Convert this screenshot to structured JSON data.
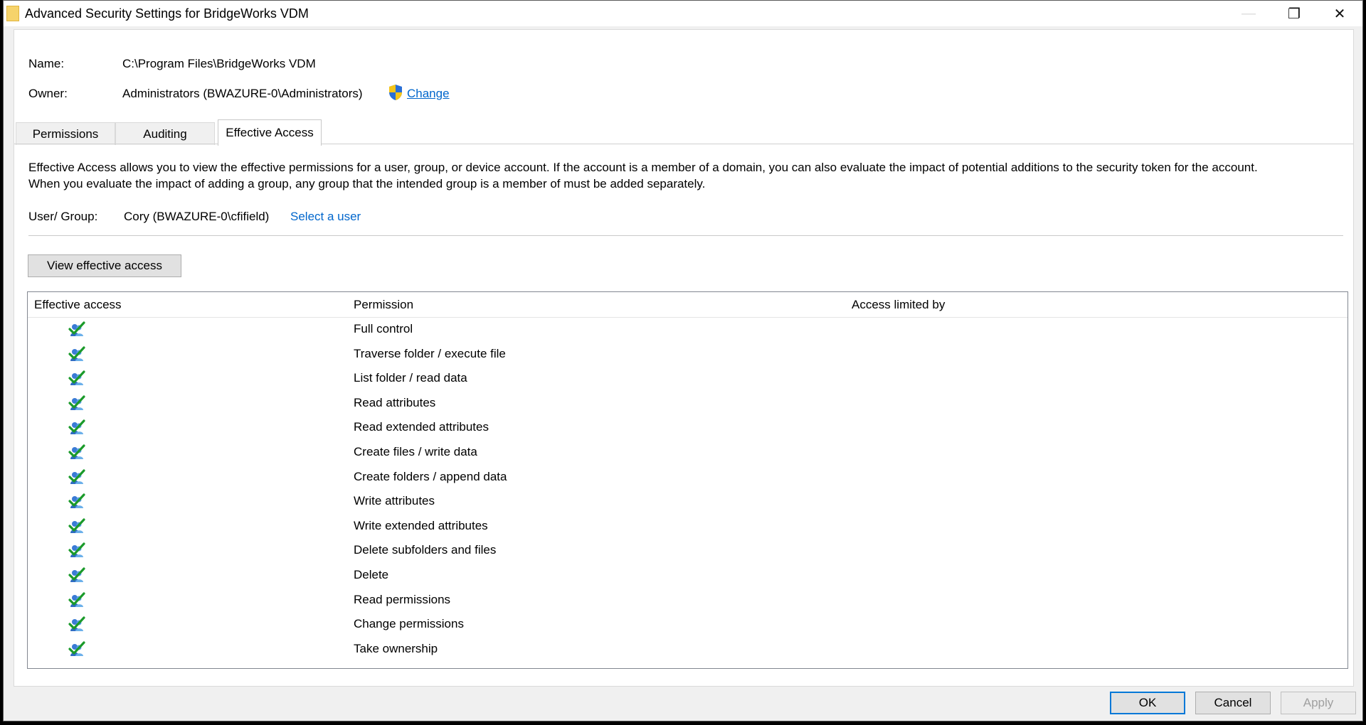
{
  "window": {
    "title": "Advanced Security Settings for BridgeWorks VDM",
    "minimize_label": "—",
    "maximize_label": "❐",
    "close_label": "✕"
  },
  "info": {
    "name_label": "Name:",
    "name_value": "C:\\Program Files\\BridgeWorks VDM",
    "owner_label": "Owner:",
    "owner_value": "Administrators (BWAZURE-0\\Administrators)",
    "change_link": "Change"
  },
  "tabs": [
    {
      "label": "Permissions",
      "active": false
    },
    {
      "label": "Auditing",
      "active": false
    },
    {
      "label": "Effective Access",
      "active": true
    }
  ],
  "effective": {
    "description_line1": "Effective Access allows you to view the effective permissions for a user, group, or device account. If the account is a member of a domain, you can also evaluate the impact of potential additions to the security token for the account.",
    "description_line2": "When you evaluate the impact of adding a group, any group that the intended group is a member of must be added separately.",
    "user_group_label": "User/ Group:",
    "user_group_value": "Cory (BWAZURE-0\\cfifield)",
    "select_user_link": "Select a user",
    "view_button": "View effective access"
  },
  "table": {
    "columns": [
      "Effective access",
      "Permission",
      "Access limited by"
    ],
    "rows": [
      {
        "permission": "Full control",
        "access_icon": "allowed-icon",
        "limited_by": ""
      },
      {
        "permission": "Traverse folder / execute file",
        "access_icon": "allowed-icon",
        "limited_by": ""
      },
      {
        "permission": "List folder / read data",
        "access_icon": "allowed-icon",
        "limited_by": ""
      },
      {
        "permission": "Read attributes",
        "access_icon": "allowed-icon",
        "limited_by": ""
      },
      {
        "permission": "Read extended attributes",
        "access_icon": "allowed-icon",
        "limited_by": ""
      },
      {
        "permission": "Create files / write data",
        "access_icon": "allowed-icon",
        "limited_by": ""
      },
      {
        "permission": "Create folders / append data",
        "access_icon": "allowed-icon",
        "limited_by": ""
      },
      {
        "permission": "Write attributes",
        "access_icon": "allowed-icon",
        "limited_by": ""
      },
      {
        "permission": "Write extended attributes",
        "access_icon": "allowed-icon",
        "limited_by": ""
      },
      {
        "permission": "Delete subfolders and files",
        "access_icon": "allowed-icon",
        "limited_by": ""
      },
      {
        "permission": "Delete",
        "access_icon": "allowed-icon",
        "limited_by": ""
      },
      {
        "permission": "Read permissions",
        "access_icon": "allowed-icon",
        "limited_by": ""
      },
      {
        "permission": "Change permissions",
        "access_icon": "allowed-icon",
        "limited_by": ""
      },
      {
        "permission": "Take ownership",
        "access_icon": "allowed-icon",
        "limited_by": ""
      }
    ]
  },
  "footer": {
    "ok": "OK",
    "cancel": "Cancel",
    "apply": "Apply"
  },
  "colors": {
    "link": "#0066cc",
    "ok_border": "#0078d7"
  }
}
